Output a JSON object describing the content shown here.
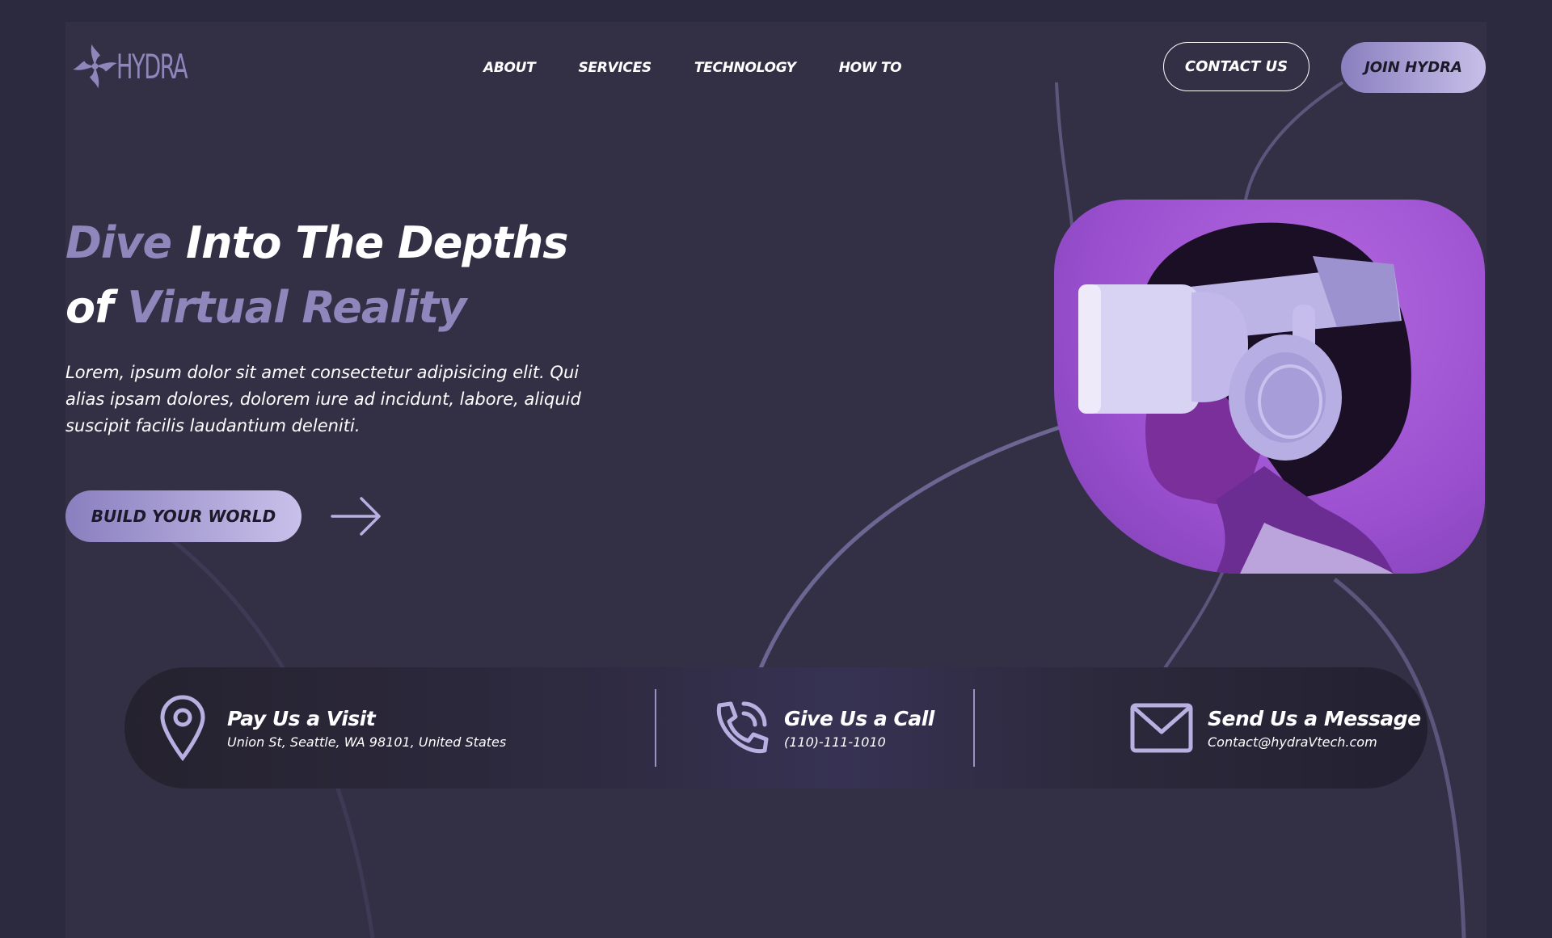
{
  "brand": {
    "name": "HYDRA",
    "logo_icon": "hydra-swirl-icon"
  },
  "nav": {
    "items": [
      "ABOUT",
      "SERVICES",
      "TECHNOLOGY",
      "HOW TO"
    ]
  },
  "header": {
    "contact_label": "CONTACT US",
    "join_label": "JOIN HYDRA"
  },
  "hero": {
    "title_accent_1": "Dive",
    "title_rest_1": " Into The Depths",
    "title_rest_2": "of ",
    "title_accent_2": "Virtual Reality",
    "description": "Lorem, ipsum dolor sit amet consectetur adipisicing elit. Qui alias ipsam dolores, dolorem iure ad incidunt, labore, aliquid suscipit facilis laudantium deleniti.",
    "cta_label": "BUILD YOUR WORLD",
    "cta_icon": "arrow-right-icon"
  },
  "contact": {
    "visit": {
      "title": "Pay Us a Visit",
      "detail": "Union St, Seattle, WA 98101, United States",
      "icon": "location-pin-icon"
    },
    "call": {
      "title": "Give Us a Call",
      "detail": "(110)-111-1010",
      "icon": "phone-icon"
    },
    "message": {
      "title": "Send Us a Message",
      "detail": "Contact@hydraVtech.com",
      "icon": "envelope-icon"
    }
  },
  "colors": {
    "background": "#333046",
    "accent": "#8f86bb",
    "button_gradient_start": "#8a7fbf",
    "button_gradient_end": "#c9c1ea",
    "image_purple": "#a855d8"
  }
}
